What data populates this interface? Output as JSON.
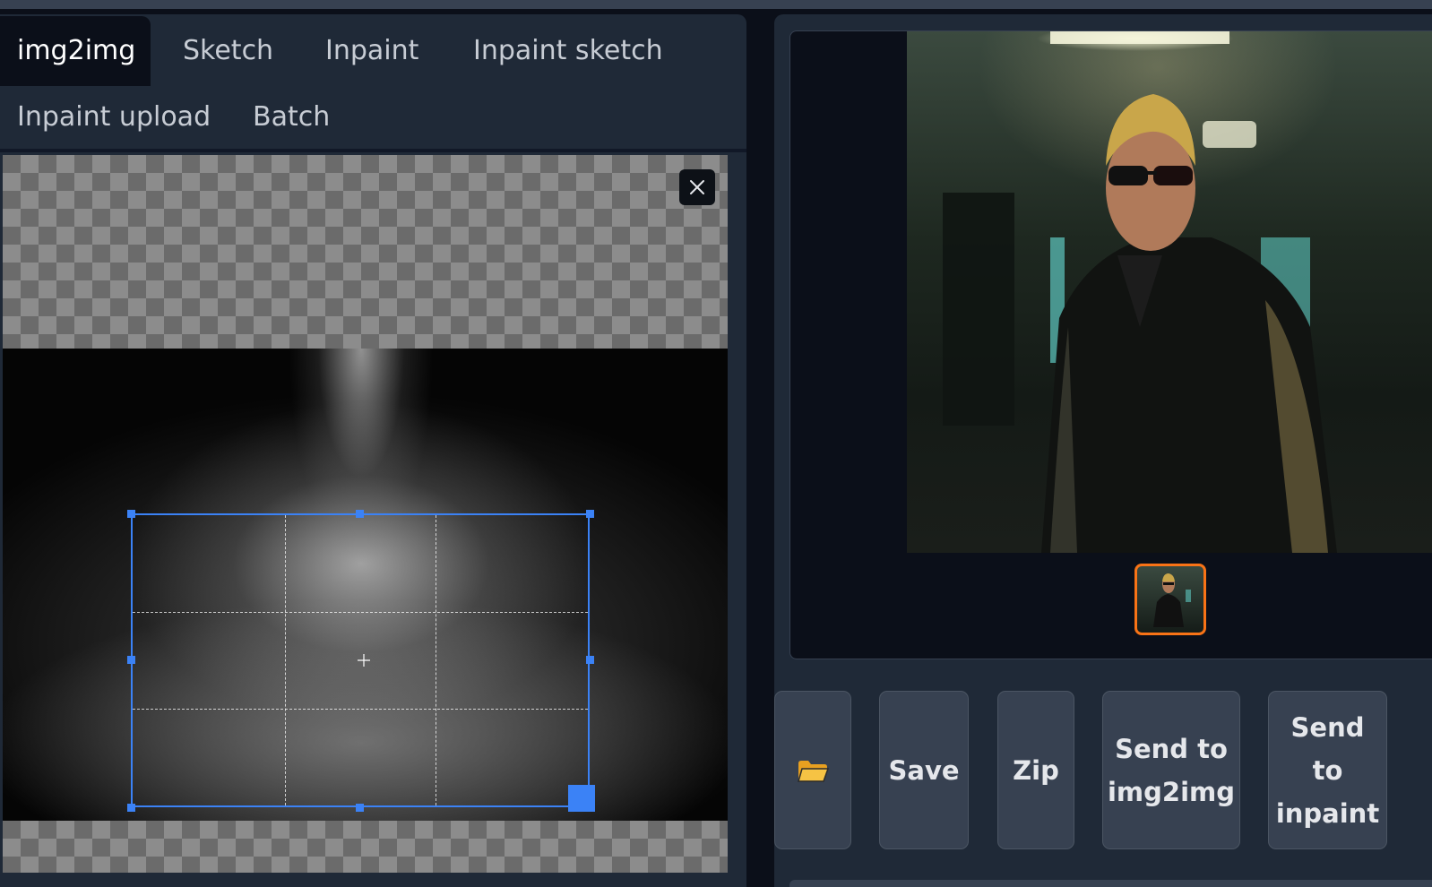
{
  "tabs": {
    "row1": [
      "img2img",
      "Sketch",
      "Inpaint",
      "Inpaint sketch"
    ],
    "row2": [
      "Inpaint upload",
      "Batch"
    ]
  },
  "editor": {
    "close_icon": "close-icon",
    "crop_handle_color": "#3b82f6"
  },
  "gallery": {
    "thumbnail_border_color": "#f97316"
  },
  "actions": {
    "open_folder_icon": "folder-icon",
    "save_label": "Save",
    "zip_label": "Zip",
    "send_img2img_line1": "Send to",
    "send_img2img_line2": "img2img",
    "send_inpaint_line1": "Send",
    "send_inpaint_line2": "to",
    "send_inpaint_line3": "inpaint"
  },
  "colors": {
    "panel": "#1f2937",
    "background": "#0b0f19",
    "button": "#374151",
    "accent": "#3b82f6"
  }
}
